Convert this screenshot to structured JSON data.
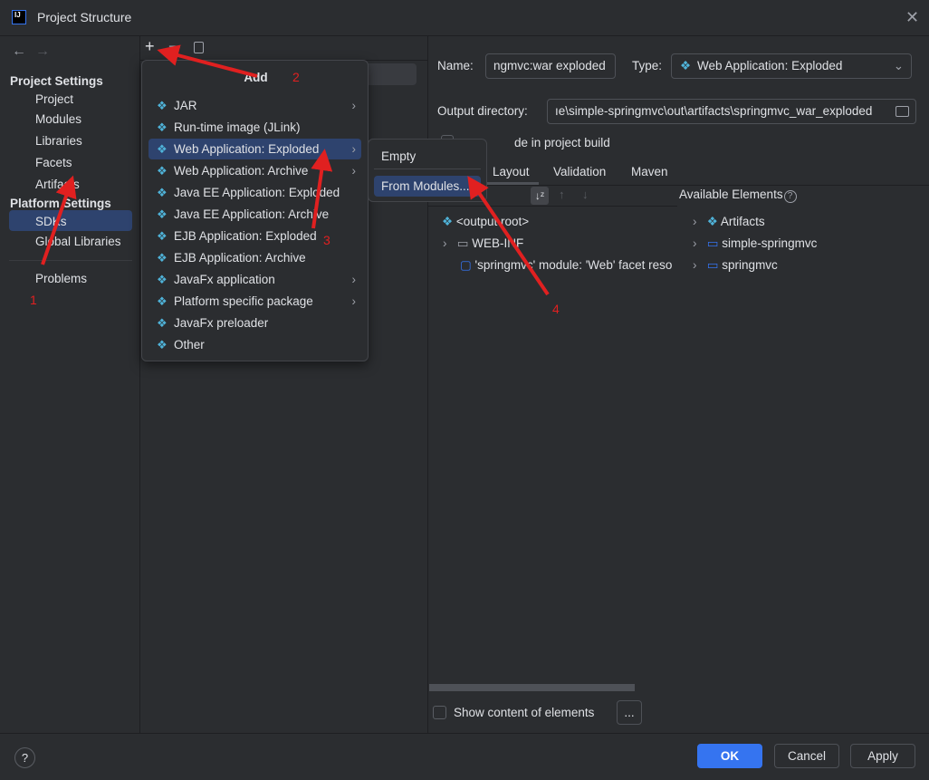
{
  "window": {
    "title": "Project Structure",
    "logo": "IJ"
  },
  "nav": {
    "back": "←",
    "forward": "→",
    "project_settings": "Project Settings",
    "items": [
      "Project",
      "Modules",
      "Libraries",
      "Facets",
      "Artifacts"
    ],
    "platform_settings": "Platform Settings",
    "platform_items": [
      "SDKs",
      "Global Libraries"
    ],
    "problems": "Problems",
    "selected": "Artifacts"
  },
  "toolbar": {
    "add": "+",
    "remove": "−",
    "copy": "copy-icon"
  },
  "add_menu": {
    "title": "Add",
    "items": [
      {
        "label": "JAR",
        "icon": "artifact-icon",
        "submenu": true
      },
      {
        "label": "Run-time image (JLink)",
        "icon": "artifact-icon",
        "submenu": false
      },
      {
        "label": "Web Application: Exploded",
        "icon": "web-icon",
        "submenu": true
      },
      {
        "label": "Web Application: Archive",
        "icon": "web-icon",
        "submenu": true
      },
      {
        "label": "Java EE Application: Exploded",
        "icon": "javaee-icon",
        "submenu": false
      },
      {
        "label": "Java EE Application: Archive",
        "icon": "javaee-icon",
        "submenu": false
      },
      {
        "label": "EJB Application: Exploded",
        "icon": "ejb-icon",
        "submenu": false
      },
      {
        "label": "EJB Application: Archive",
        "icon": "ejb-icon",
        "submenu": false
      },
      {
        "label": "JavaFx application",
        "icon": "artifact-icon",
        "submenu": true
      },
      {
        "label": "Platform specific package",
        "icon": "artifact-icon",
        "submenu": true
      },
      {
        "label": "JavaFx preloader",
        "icon": "artifact-icon",
        "submenu": false
      },
      {
        "label": "Other",
        "icon": "artifact-icon",
        "submenu": false
      }
    ],
    "highlighted": "Web Application: Exploded"
  },
  "submenu": {
    "items": [
      "Empty",
      "From Modules..."
    ],
    "highlighted": "From Modules..."
  },
  "details": {
    "name_label": "Name:",
    "name_value": "ngmvc:war exploded",
    "type_label": "Type:",
    "type_value": "Web Application: Exploded",
    "output_label": "Output directory:",
    "output_value": "ıe\\simple-springmvc\\out\\artifacts\\springmvc_war_exploded",
    "include_label": "Include in project build",
    "include_visible": "de in project build",
    "tabs": [
      "Layout",
      "Validation",
      "Maven"
    ],
    "active_tab": "Layout",
    "available_label": "Available Elements",
    "tree": [
      "<output root>",
      "WEB-INF",
      "'springmvc' module: 'Web' facet reso"
    ],
    "available": [
      "Artifacts",
      "simple-springmvc",
      "springmvc"
    ],
    "show_content": "Show content of elements",
    "more": "..."
  },
  "footer": {
    "help": "?",
    "ok": "OK",
    "cancel": "Cancel",
    "apply": "Apply"
  },
  "annotations": [
    "1",
    "2",
    "3",
    "4"
  ],
  "colors": {
    "accent": "#3574f0",
    "selection": "#2e436e",
    "annotation": "#e02020",
    "background": "#2b2d30"
  }
}
